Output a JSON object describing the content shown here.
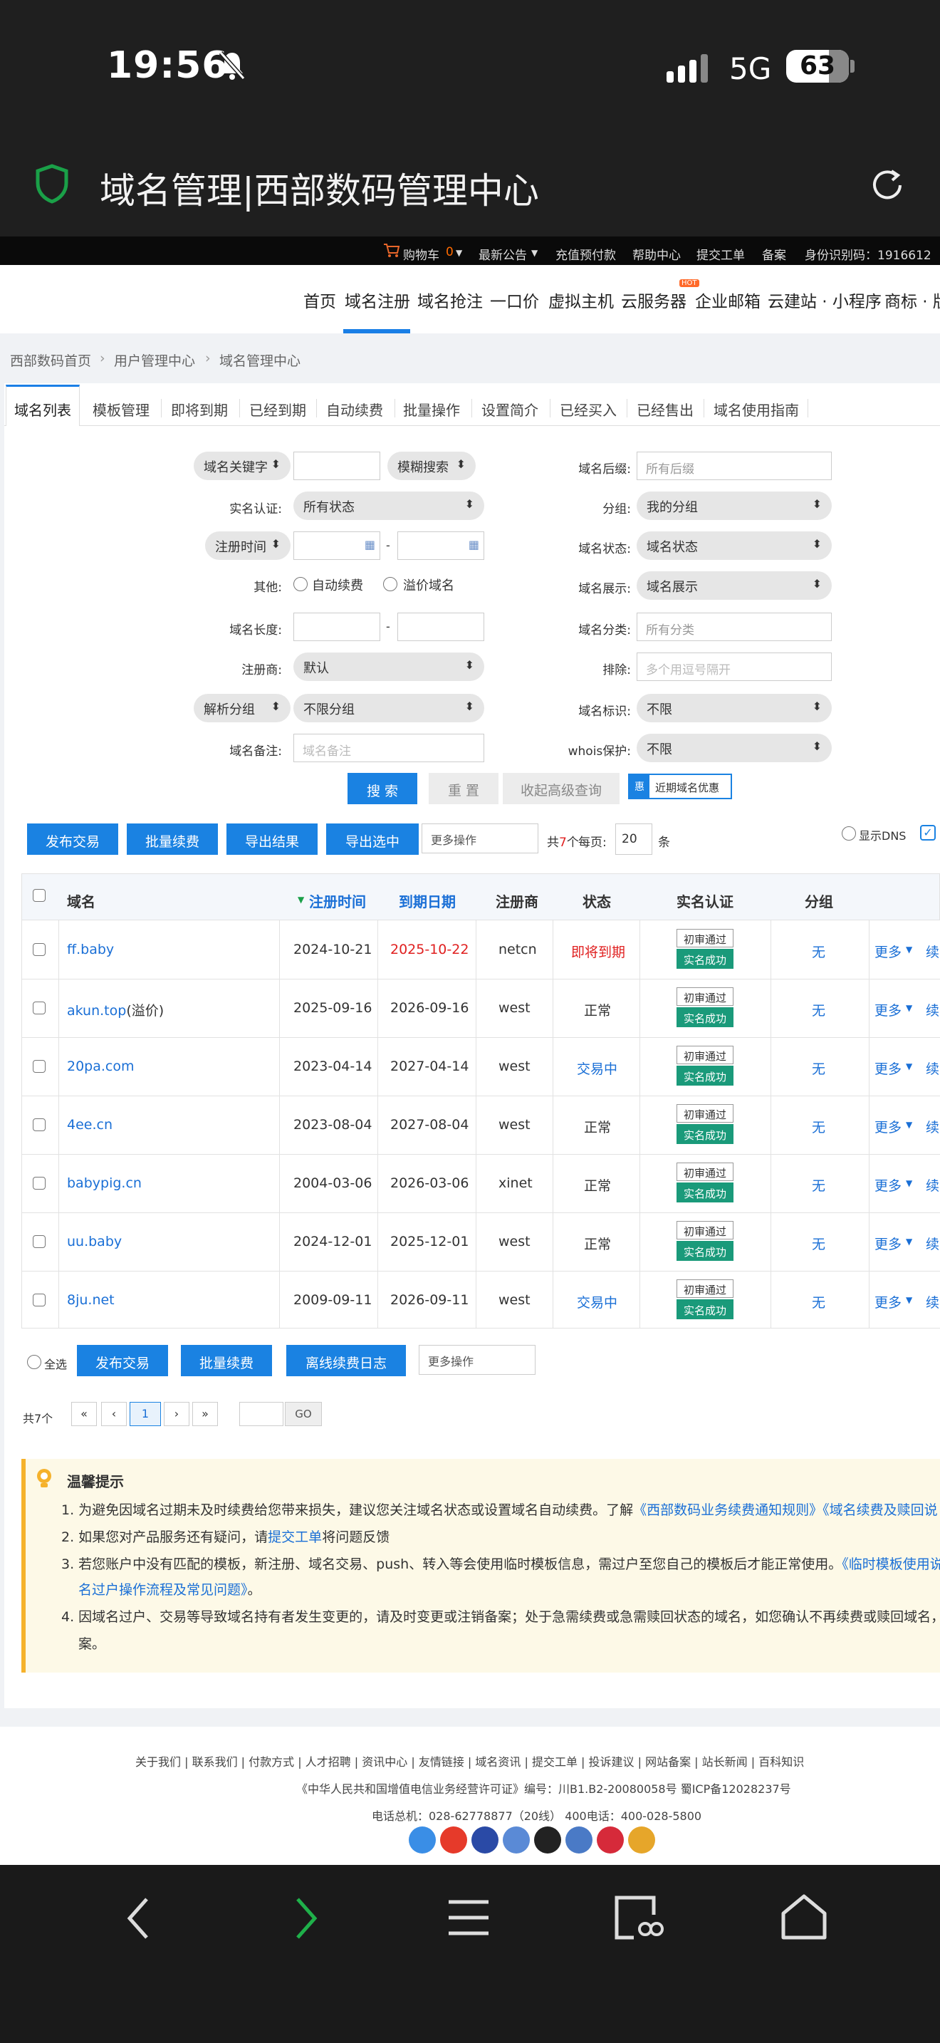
{
  "status_bar": {
    "time": "19:56",
    "network": "5G",
    "battery": "63"
  },
  "app": {
    "title": "域名管理|西部数码管理中心"
  },
  "site_bar": {
    "cart": "购物车",
    "cart_count": "0",
    "announce": "最新公告",
    "recharge": "充值预付款",
    "help": "帮助中心",
    "ticket": "提交工单",
    "beian": "备案",
    "id_label": "身份识别码：1916612"
  },
  "nav": {
    "items": [
      "首页",
      "域名注册",
      "域名抢注",
      "一口价",
      "虚拟主机",
      "云服务器",
      "企业邮箱",
      "云建站 · 小程序",
      "商标 · 版"
    ],
    "hot": "HOT"
  },
  "breadcrumb": [
    "西部数码首页",
    "用户管理中心",
    "域名管理中心"
  ],
  "tabs": [
    "域名列表",
    "模板管理",
    "即将到期",
    "已经到期",
    "自动续费",
    "批量操作",
    "设置简介",
    "已经买入",
    "已经售出",
    "域名使用指南"
  ],
  "filters": {
    "keyword_select": "域名关键字",
    "fuzzy_select": "模糊搜索",
    "suffix_label": "域名后缀:",
    "suffix_placeholder": "所有后缀",
    "realname_label": "实名认证:",
    "realname_value": "所有状态",
    "group_label": "分组:",
    "group_value": "我的分组",
    "regtime_select": "注册时间",
    "dash": "-",
    "status_label": "域名状态:",
    "status_value": "域名状态",
    "other_label": "其他:",
    "auto_renew": "自动续费",
    "premium": "溢价域名",
    "display_label": "域名展示:",
    "display_value": "域名展示",
    "length_label": "域名长度:",
    "category_label": "域名分类:",
    "category_placeholder": "所有分类",
    "registrar_label": "注册商:",
    "registrar_value": "默认",
    "exclude_label": "排除:",
    "exclude_placeholder": "多个用逗号隔开",
    "resolve_group_select": "解析分组",
    "resolve_group_value": "不限分组",
    "mark_label": "域名标识:",
    "mark_value": "不限",
    "note_label": "域名备注:",
    "note_placeholder": "域名备注",
    "whois_label": "whois保护:",
    "whois_value": "不限",
    "search_btn": "搜 索",
    "reset_btn": "重 置",
    "collapse_btn": "收起高级查询",
    "promo_tag": "惠",
    "promo_text": "近期域名优惠"
  },
  "toolbar": {
    "publish": "发布交易",
    "batch_renew": "批量续费",
    "export_result": "导出结果",
    "export_selected": "导出选中",
    "more_ops": "更多操作",
    "total_prefix": "共",
    "total_count": "7",
    "total_suffix": "个",
    "per_page_label": "每页:",
    "per_page": "20",
    "per_page_unit": "条",
    "show_dns": "显示DNS"
  },
  "table": {
    "headers": [
      "域名",
      "注册时间",
      "到期日期",
      "注册商",
      "状态",
      "实名认证",
      "分组"
    ],
    "badge_top": "初审通过",
    "badge_bottom": "实名成功",
    "more": "更多",
    "renew": "续",
    "rows": [
      {
        "domain": "ff.baby",
        "suffix": "",
        "reg": "2024-10-21",
        "exp": "2025-10-22",
        "registrar": "netcn",
        "status": "即将到期",
        "group": "无"
      },
      {
        "domain": "akun.top",
        "suffix": "(溢价)",
        "reg": "2025-09-16",
        "exp": "2026-09-16",
        "registrar": "west",
        "status": "正常",
        "group": "无"
      },
      {
        "domain": "20pa.com",
        "suffix": "",
        "reg": "2023-04-14",
        "exp": "2027-04-14",
        "registrar": "west",
        "status": "交易中",
        "group": "无"
      },
      {
        "domain": "4ee.cn",
        "suffix": "",
        "reg": "2023-08-04",
        "exp": "2027-08-04",
        "registrar": "west",
        "status": "正常",
        "group": "无"
      },
      {
        "domain": "babypig.cn",
        "suffix": "",
        "reg": "2004-03-06",
        "exp": "2026-03-06",
        "registrar": "xinet",
        "status": "正常",
        "group": "无"
      },
      {
        "domain": "uu.baby",
        "suffix": "",
        "reg": "2024-12-01",
        "exp": "2025-12-01",
        "registrar": "west",
        "status": "正常",
        "group": "无"
      },
      {
        "domain": "8ju.net",
        "suffix": "",
        "reg": "2009-09-11",
        "exp": "2026-09-11",
        "registrar": "west",
        "status": "交易中",
        "group": "无"
      }
    ]
  },
  "bottom_toolbar": {
    "select_all": "全选",
    "publish": "发布交易",
    "batch_renew": "批量续费",
    "offline_log": "离线续费日志",
    "more_ops": "更多操作"
  },
  "pagination": {
    "total": "共7个",
    "first": "«",
    "prev": "‹",
    "page": "1",
    "next": "›",
    "last": "»",
    "go": "GO"
  },
  "tips": {
    "title": "温馨提示",
    "t1": "1.  为避免因域名过期未及时续费给您带来损失，建议您关注域名状态或设置域名自动续费。了解",
    "t1_link": "《西部数码业务续费通知规则》《域名续费及赎回说",
    "t2a": "2.  如果您对产品服务还有疑问，请",
    "t2_link": "提交工单",
    "t2b": "将问题反馈",
    "t3": "3.  若您账户中没有匹配的模板，新注册、域名交易、push、转入等会使用临时模板信息，需过户至您自己的模板后才能正常使用。",
    "t3_link": "《临时模板使用说",
    "t3_link2": "名过户操作流程及常见问题》",
    "t3_end": "。",
    "t4": "4.  因域名过户、交易等导致域名持有者发生变更的，请及时变更或注销备案；处于急需续费或急需赎回状态的域名，如您确认不再续费或赎回域名，",
    "t4_end": "案。"
  },
  "footer": {
    "links": "关于我们  |  联系我们  |  付款方式  |  人才招聘  |  资讯中心  |  友情链接  |  域名资讯  |  提交工单  |  投诉建议  |  网站备案  |  站长新闻  |  百科知识",
    "license": "《中华人民共和国增值电信业务经营许可证》编号：川B1.B2-20080058号  蜀ICP备12028237号",
    "phone": "电话总机：028-62778877（20线）     400电话：400-028-5800"
  }
}
